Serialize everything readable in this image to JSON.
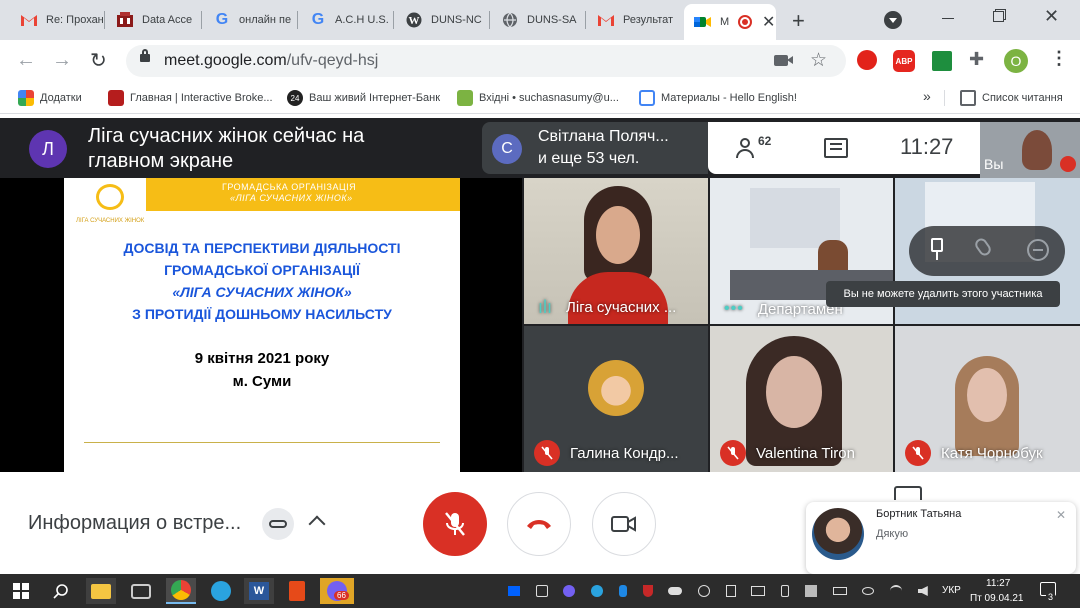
{
  "browser": {
    "tabs": [
      {
        "label": "Re: Прохан",
        "icon": "gmail-icon"
      },
      {
        "label": "Data Acce",
        "icon": "data-access-icon"
      },
      {
        "label": "онлайн пе",
        "icon": "google-icon"
      },
      {
        "label": "A.C.H U.S.",
        "icon": "google-icon"
      },
      {
        "label": "DUNS-NC",
        "icon": "wordpress-icon"
      },
      {
        "label": "DUNS-SA",
        "icon": "globe-icon"
      },
      {
        "label": "Результат",
        "icon": "gmail-icon"
      },
      {
        "label": "М",
        "icon": "meet-icon"
      }
    ],
    "url_host": "meet.google.com",
    "url_path": "/ufv-qeyd-hsj",
    "profile_initial": "O",
    "bookmarks": [
      {
        "label": "Додатки",
        "icon": "apps-icon"
      },
      {
        "label": "Главная | Interactive Broke...",
        "icon": "ib-icon"
      },
      {
        "label": "Ваш живий Інтернет-Банк",
        "icon": "bank24-icon"
      },
      {
        "label": "Вхідні • suchasnasumy@u...",
        "icon": "inbox-icon"
      },
      {
        "label": "Материалы - Hello English!",
        "icon": "page-icon"
      }
    ],
    "more_bookmarks": "»",
    "reading_list": "Список читання",
    "extension_abp": "ABP"
  },
  "meet": {
    "presenter_initial": "Л",
    "presenter_text": "Ліга сучасних жінок сейчас на главном экране",
    "caller_initial": "С",
    "caller_name": "Світлана Поляч...",
    "caller_more": "и еще 53 чел.",
    "participants_count": "62",
    "time": "11:27",
    "self_label": "Вы",
    "slide": {
      "org_line1": "ГРОМАДСЬКА ОРГАНІЗАЦІЯ",
      "org_line2": "«ЛІГА СУЧАСНИХ ЖІНОК»",
      "logo_caption": "ЛІГА СУЧАСНИХ ЖІНОК",
      "title_l1": "ДОСВІД ТА ПЕРСПЕКТИВИ ДІЯЛЬНОСТІ",
      "title_l2": "ГРОМАДСЬКОЇ ОРГАНІЗАЦІЇ",
      "title_l3": "«ЛІГА СУЧАСНИХ ЖІНОК»",
      "title_l4": "З ПРОТИДІЇ ДОШНЬОМУ НАСИЛЬСТУ",
      "date": "9 квітня 2021 року",
      "city": "м. Суми"
    },
    "tiles": [
      {
        "name": "Ліга сучасних ..."
      },
      {
        "name": "Департамен"
      },
      {
        "name": "Галина Кондр..."
      },
      {
        "name": "Valentina Tiron"
      },
      {
        "name": "Катя Чорнобук"
      }
    ],
    "tooltip": "Вы не можете удалить этого участника",
    "meeting_info": "Информация о встре...",
    "toast_name": "Бортник Татьяна",
    "toast_message": "Дякую"
  },
  "taskbar": {
    "time": "11:27",
    "date": "Пт 09.04.21",
    "lang": "УКР",
    "viber_badge": "66",
    "notifications": "3"
  },
  "colors": {
    "meet_bg": "#202124",
    "leave_red": "#d93025",
    "slide_title_blue": "#1a56db",
    "slide_band_yellow": "#f6bd16"
  }
}
